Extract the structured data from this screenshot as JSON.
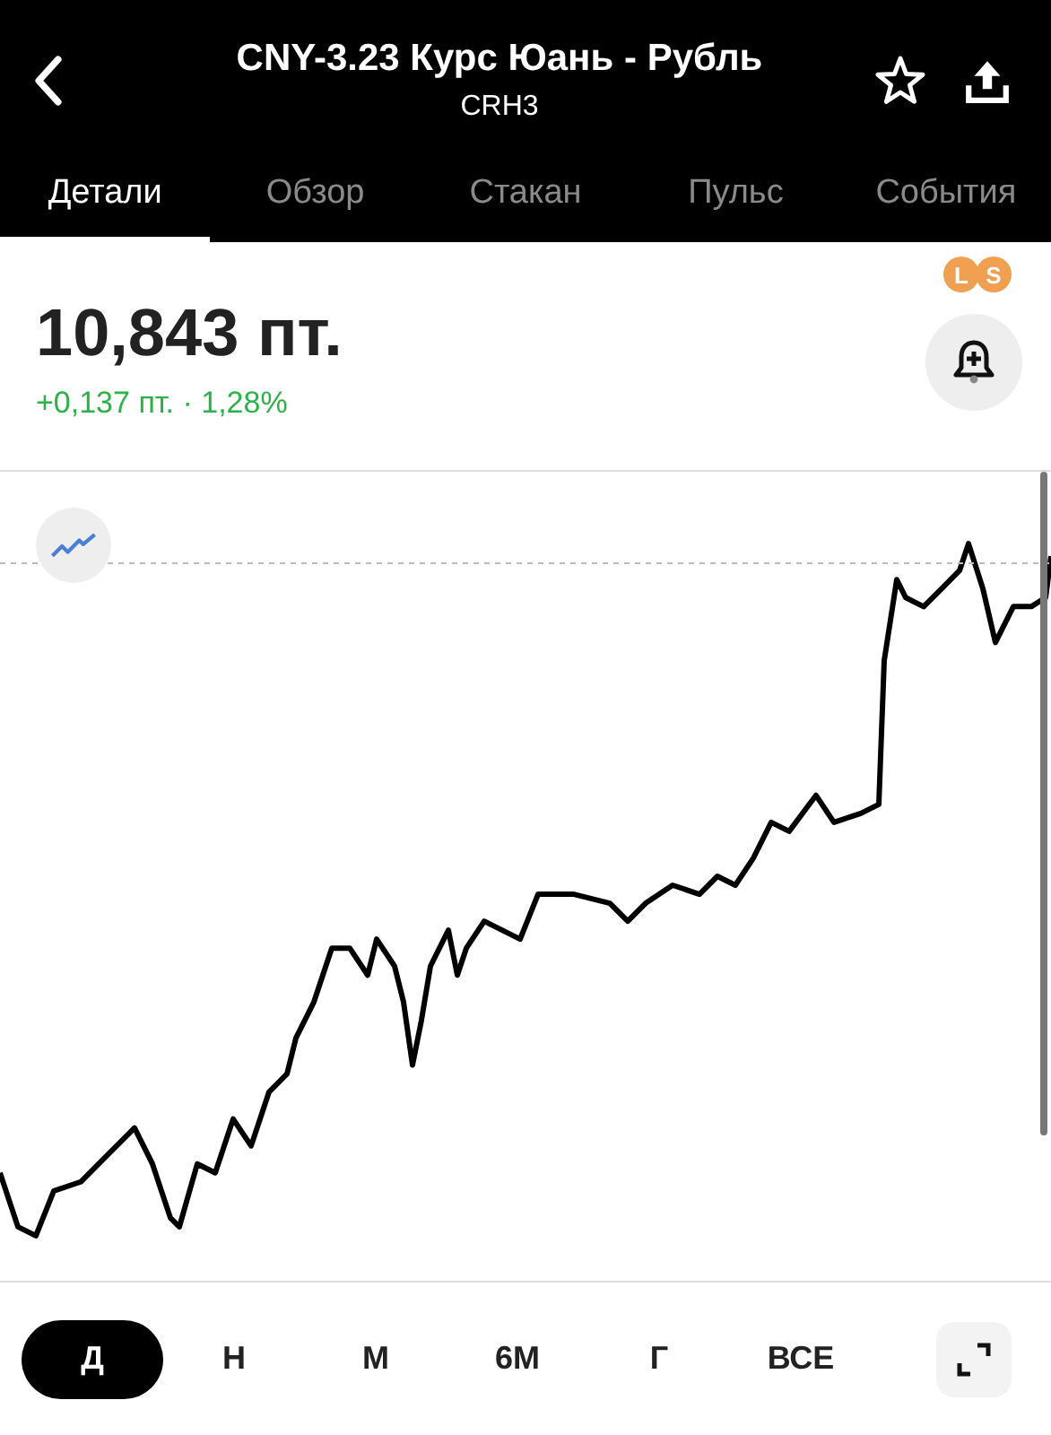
{
  "header": {
    "title": "CNY-3.23 Курс Юань - Рубль",
    "subtitle": "CRH3"
  },
  "tabs": [
    {
      "label": "Детали",
      "selected": true
    },
    {
      "label": "Обзор",
      "selected": false
    },
    {
      "label": "Стакан",
      "selected": false
    },
    {
      "label": "Пульс",
      "selected": false
    },
    {
      "label": "События",
      "selected": false
    }
  ],
  "badges": [
    "L",
    "S"
  ],
  "price": {
    "value": "10,843 пт.",
    "change": "+0,137 пт. · 1,28%"
  },
  "periods": [
    {
      "label": "Д",
      "selected": true
    },
    {
      "label": "Н",
      "selected": false
    },
    {
      "label": "М",
      "selected": false
    },
    {
      "label": "6М",
      "selected": false
    },
    {
      "label": "Г",
      "selected": false
    },
    {
      "label": "ВСЕ",
      "selected": false
    }
  ]
}
